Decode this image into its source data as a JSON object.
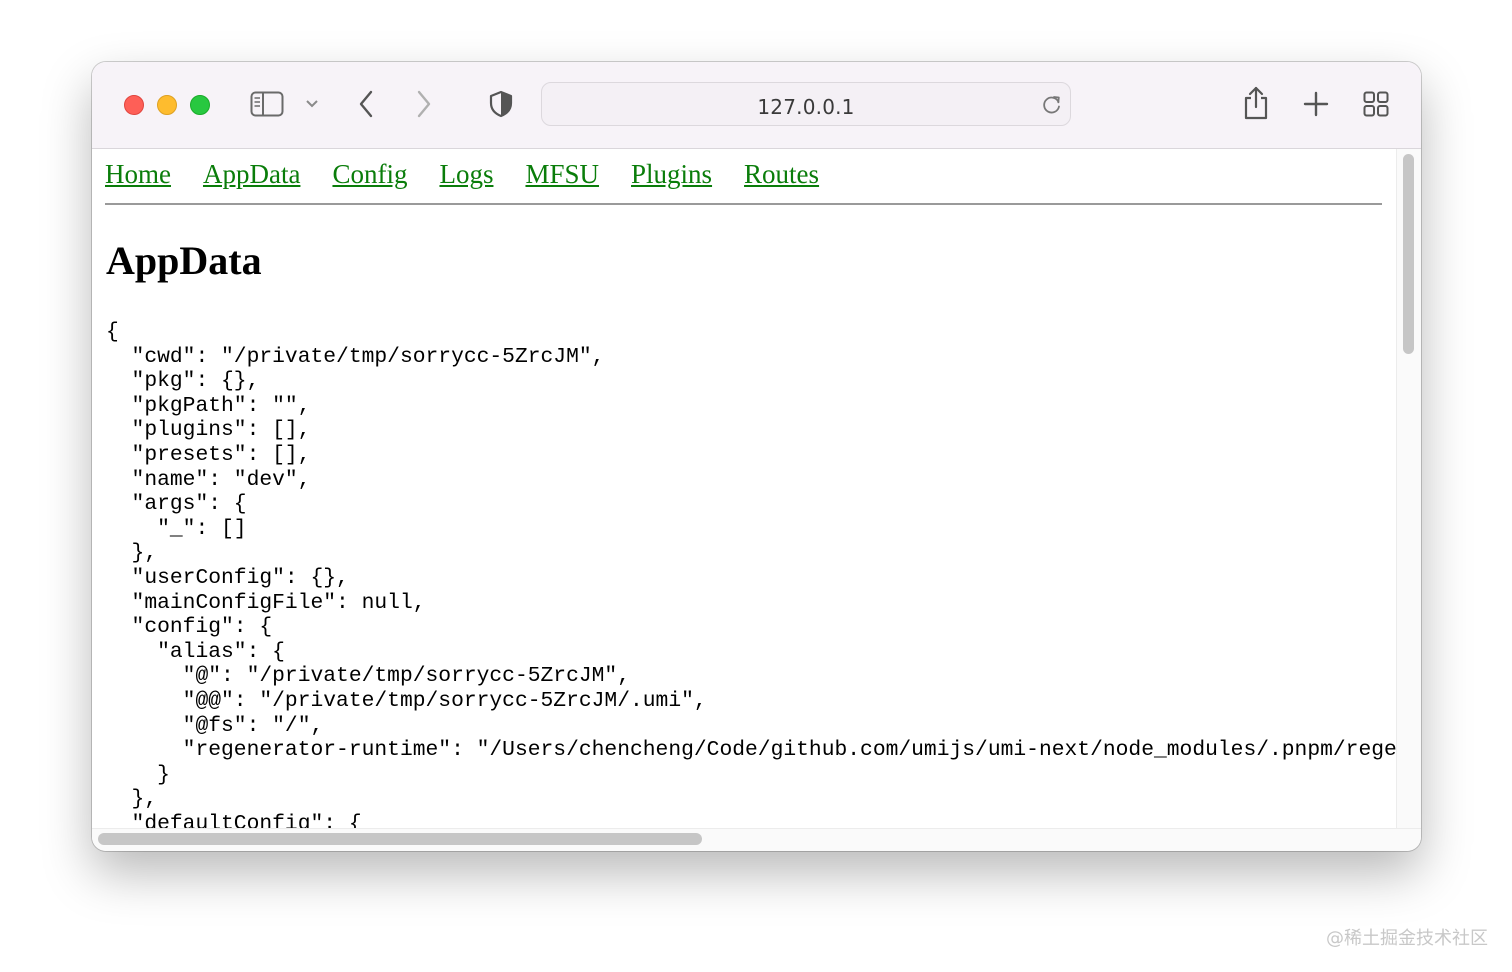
{
  "browser": {
    "url": "127.0.0.1",
    "traffic_lights": {
      "close": "#fe5f57",
      "minimize": "#febc2e",
      "zoom": "#28c840"
    },
    "icons": {
      "sidebar": "sidebar-icon",
      "sidebar_menu": "chevron-down-icon",
      "back": "chevron-left-icon",
      "forward": "chevron-right-icon",
      "privacy": "shield-icon",
      "reload": "reload-icon",
      "share": "share-icon",
      "new_tab": "plus-icon",
      "tab_overview": "grid-icon"
    }
  },
  "page": {
    "nav": [
      "Home",
      "AppData",
      "Config",
      "Logs",
      "MFSU",
      "Plugins",
      "Routes"
    ],
    "link_color": "#0a7d0a",
    "heading": "AppData",
    "json_lines": [
      "{",
      "  \"cwd\": \"/private/tmp/sorrycc-5ZrcJM\",",
      "  \"pkg\": {},",
      "  \"pkgPath\": \"\",",
      "  \"plugins\": [],",
      "  \"presets\": [],",
      "  \"name\": \"dev\",",
      "  \"args\": {",
      "    \"_\": []",
      "  },",
      "  \"userConfig\": {},",
      "  \"mainConfigFile\": null,",
      "  \"config\": {",
      "    \"alias\": {",
      "      \"@\": \"/private/tmp/sorrycc-5ZrcJM\",",
      "      \"@@\": \"/private/tmp/sorrycc-5ZrcJM/.umi\",",
      "      \"@fs\": \"/\",",
      "      \"regenerator-runtime\": \"/Users/chencheng/Code/github.com/umijs/umi-next/node_modules/.pnpm/rege",
      "    }",
      "  },",
      "  \"defaultConfig\": {"
    ]
  },
  "watermark": "@稀土掘金技术社区"
}
